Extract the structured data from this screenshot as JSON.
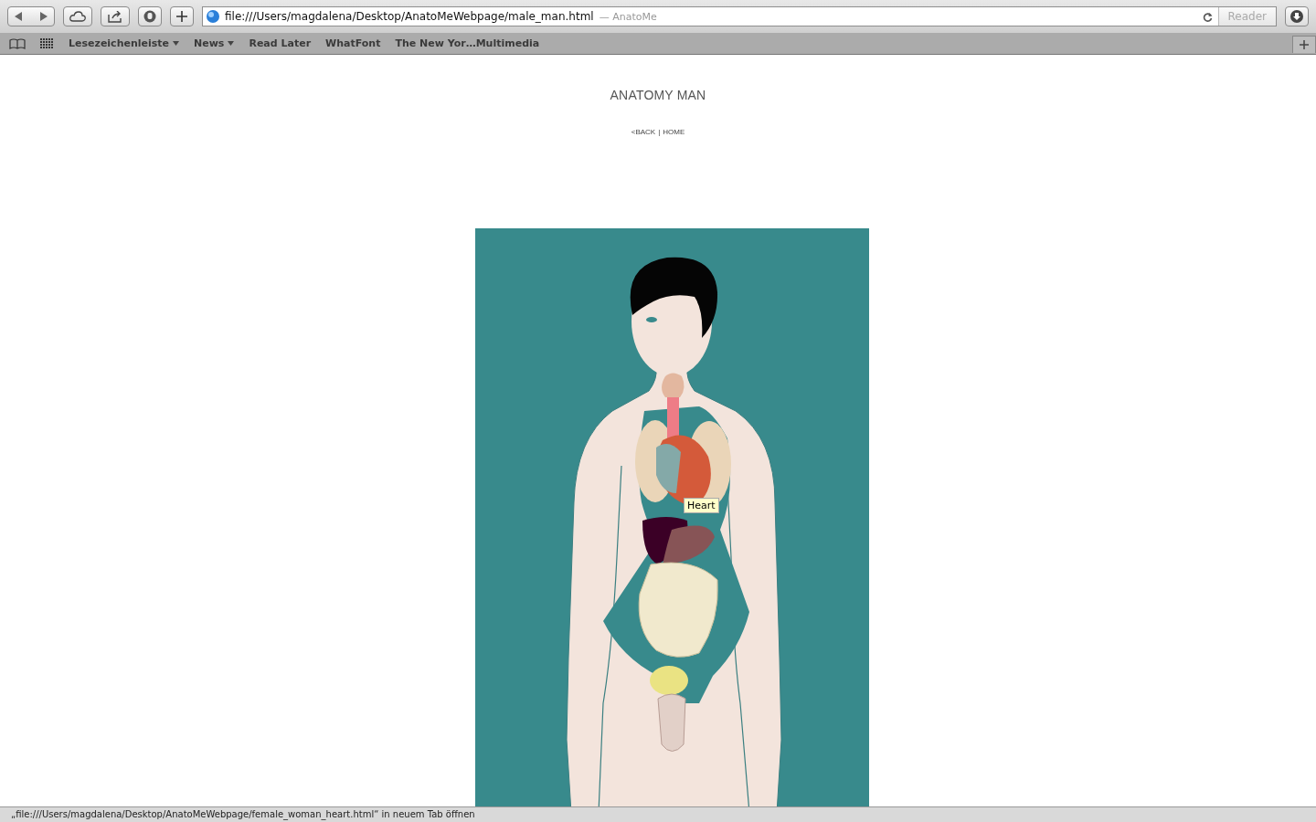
{
  "browser": {
    "url": "file:///Users/magdalena/Desktop/AnatoMeWebpage/male_man.html",
    "page_title": "— AnatoMe",
    "reader": "Reader",
    "bookmarks": [
      {
        "label": "Lesezeichenleiste",
        "kind": "menu"
      },
      {
        "label": "News",
        "kind": "menu"
      },
      {
        "label": "Read Later",
        "kind": "link"
      },
      {
        "label": "WhatFont",
        "kind": "link"
      },
      {
        "label": "The New Yor…Multimedia",
        "kind": "link"
      }
    ]
  },
  "page": {
    "title": "ANATOMY MAN",
    "nav": {
      "back": "<BACK",
      "separator": "|",
      "home": "HOME"
    }
  },
  "tooltip": "Heart",
  "status_bar": "„file:///Users/magdalena/Desktop/AnatoMeWebpage/female_woman_heart.html“ in neuem Tab öffnen"
}
